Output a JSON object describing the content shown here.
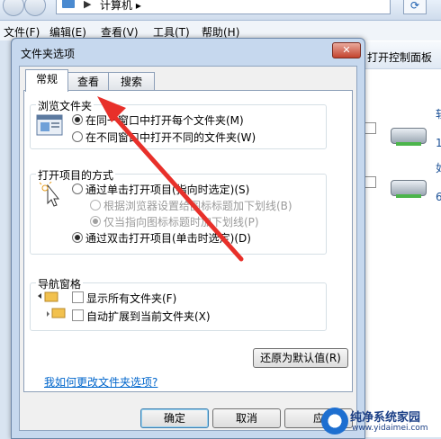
{
  "explorer": {
    "address": {
      "sep": "▶",
      "crumb": "计算机 ▸"
    },
    "menu": [
      "文件(F)",
      "编辑(E)",
      "查看(V)",
      "工具(T)",
      "帮助(H)"
    ],
    "right_pane": {
      "control_panel": "打开控制面板",
      "edge_chars": [
        "软",
        "1",
        "如",
        "6"
      ]
    }
  },
  "dialog": {
    "title": "文件夹选项",
    "close_label": "✕",
    "tabs": [
      "常规",
      "查看",
      "搜索"
    ],
    "browse_group": {
      "label": "浏览文件夹",
      "options": [
        "在同一窗口中打开每个文件夹(M)",
        "在不同窗口中打开不同的文件夹(W)"
      ],
      "selected": 0
    },
    "open_group": {
      "label": "打开项目的方式",
      "options": [
        "通过单击打开项目(指向时选定)(S)",
        "根据浏览器设置给图标标题加下划线(B)",
        "仅当指向图标标题时加下划线(P)",
        "通过双击打开项目(单击时选定)(D)"
      ]
    },
    "nav_group": {
      "label": "导航窗格",
      "options": [
        "显示所有文件夹(F)",
        "自动扩展到当前文件夹(X)"
      ]
    },
    "restore_label": "还原为默认值(R)",
    "help_link": "我如何更改文件夹选项?",
    "buttons": {
      "ok": "确定",
      "cancel": "取消",
      "apply": "应"
    }
  },
  "watermark": {
    "title": "纯净系统家园",
    "url": "www.yidaimei.com"
  },
  "colors": {
    "arrow": "#e8302a",
    "link": "#0066cc"
  }
}
